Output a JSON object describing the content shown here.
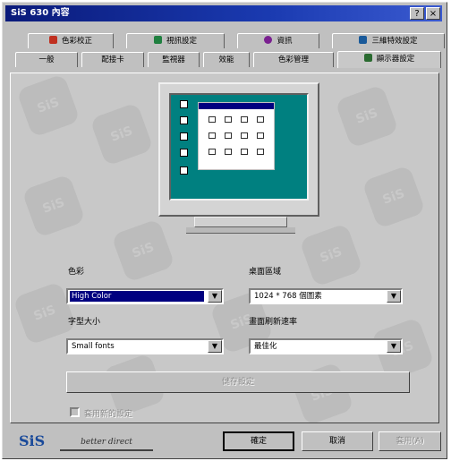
{
  "window": {
    "title": "SiS 630 內容",
    "help_button": "?",
    "close_button": "×"
  },
  "tabs_row1": [
    {
      "label": "色彩校正",
      "icon": "color-correction-icon",
      "color": "#c03020"
    },
    {
      "label": "視訊設定",
      "icon": "video-settings-icon",
      "color": "#208040"
    },
    {
      "label": "資訊",
      "icon": "info-icon",
      "color": "#7a2090"
    },
    {
      "label": "三維特效設定",
      "icon": "3d-settings-icon",
      "color": "#1a5a9a"
    }
  ],
  "tabs_row2": [
    {
      "label": "一般"
    },
    {
      "label": "配接卡"
    },
    {
      "label": "監視器"
    },
    {
      "label": "效能"
    },
    {
      "label": "色彩管理"
    },
    {
      "label": "顯示器設定",
      "icon": "display-settings-icon",
      "color": "#2a6a30",
      "active": true
    }
  ],
  "settings": {
    "color_label": "色彩",
    "color_value": "High Color",
    "desktop_area_label": "桌面區域",
    "desktop_area_value": "1024 * 768 個圖素",
    "font_size_label": "字型大小",
    "font_size_value": "Small fonts",
    "refresh_rate_label": "畫面刷新速率",
    "refresh_rate_value": "最佳化",
    "save_button": "儲存設定",
    "checkbox_label": "套用新的設定"
  },
  "footer": {
    "logo_text": "SiS",
    "slogan": "better direct",
    "ok_button": "確定",
    "cancel_button": "取消",
    "apply_button": "套用(A)"
  },
  "colors": {
    "title_bar": "#0a1a7a",
    "desktop": "#008080",
    "selection": "#000080",
    "dialog": "#c0c0c0"
  }
}
